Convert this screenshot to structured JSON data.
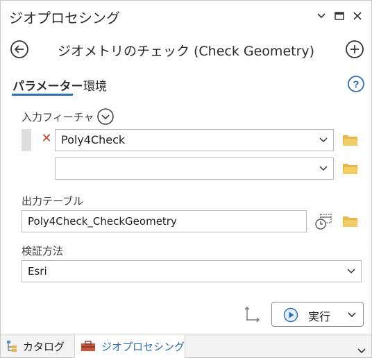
{
  "pane": {
    "title": "ジオプロセシング"
  },
  "tool": {
    "title": "ジオメトリのチェック (Check Geometry)"
  },
  "tabs": [
    {
      "label": "パラメーター",
      "active": true
    },
    {
      "label": "環境",
      "active": false
    }
  ],
  "params": {
    "input_features": {
      "label": "入力フィーチャ",
      "values": [
        "Poly4Check",
        ""
      ]
    },
    "output_table": {
      "label": "出力テーブル",
      "value": "Poly4Check_CheckGeometry"
    },
    "validation_method": {
      "label": "検証方法",
      "value": "Esri"
    }
  },
  "footer": {
    "run_label": "実行"
  },
  "bottom_tabs": [
    {
      "label": "カタログ",
      "active": false
    },
    {
      "label": "ジオプロセシング",
      "active": true
    }
  ],
  "colors": {
    "accent": "#2a6eb5",
    "remove": "#c2452b",
    "folder": "#e6b84a"
  }
}
